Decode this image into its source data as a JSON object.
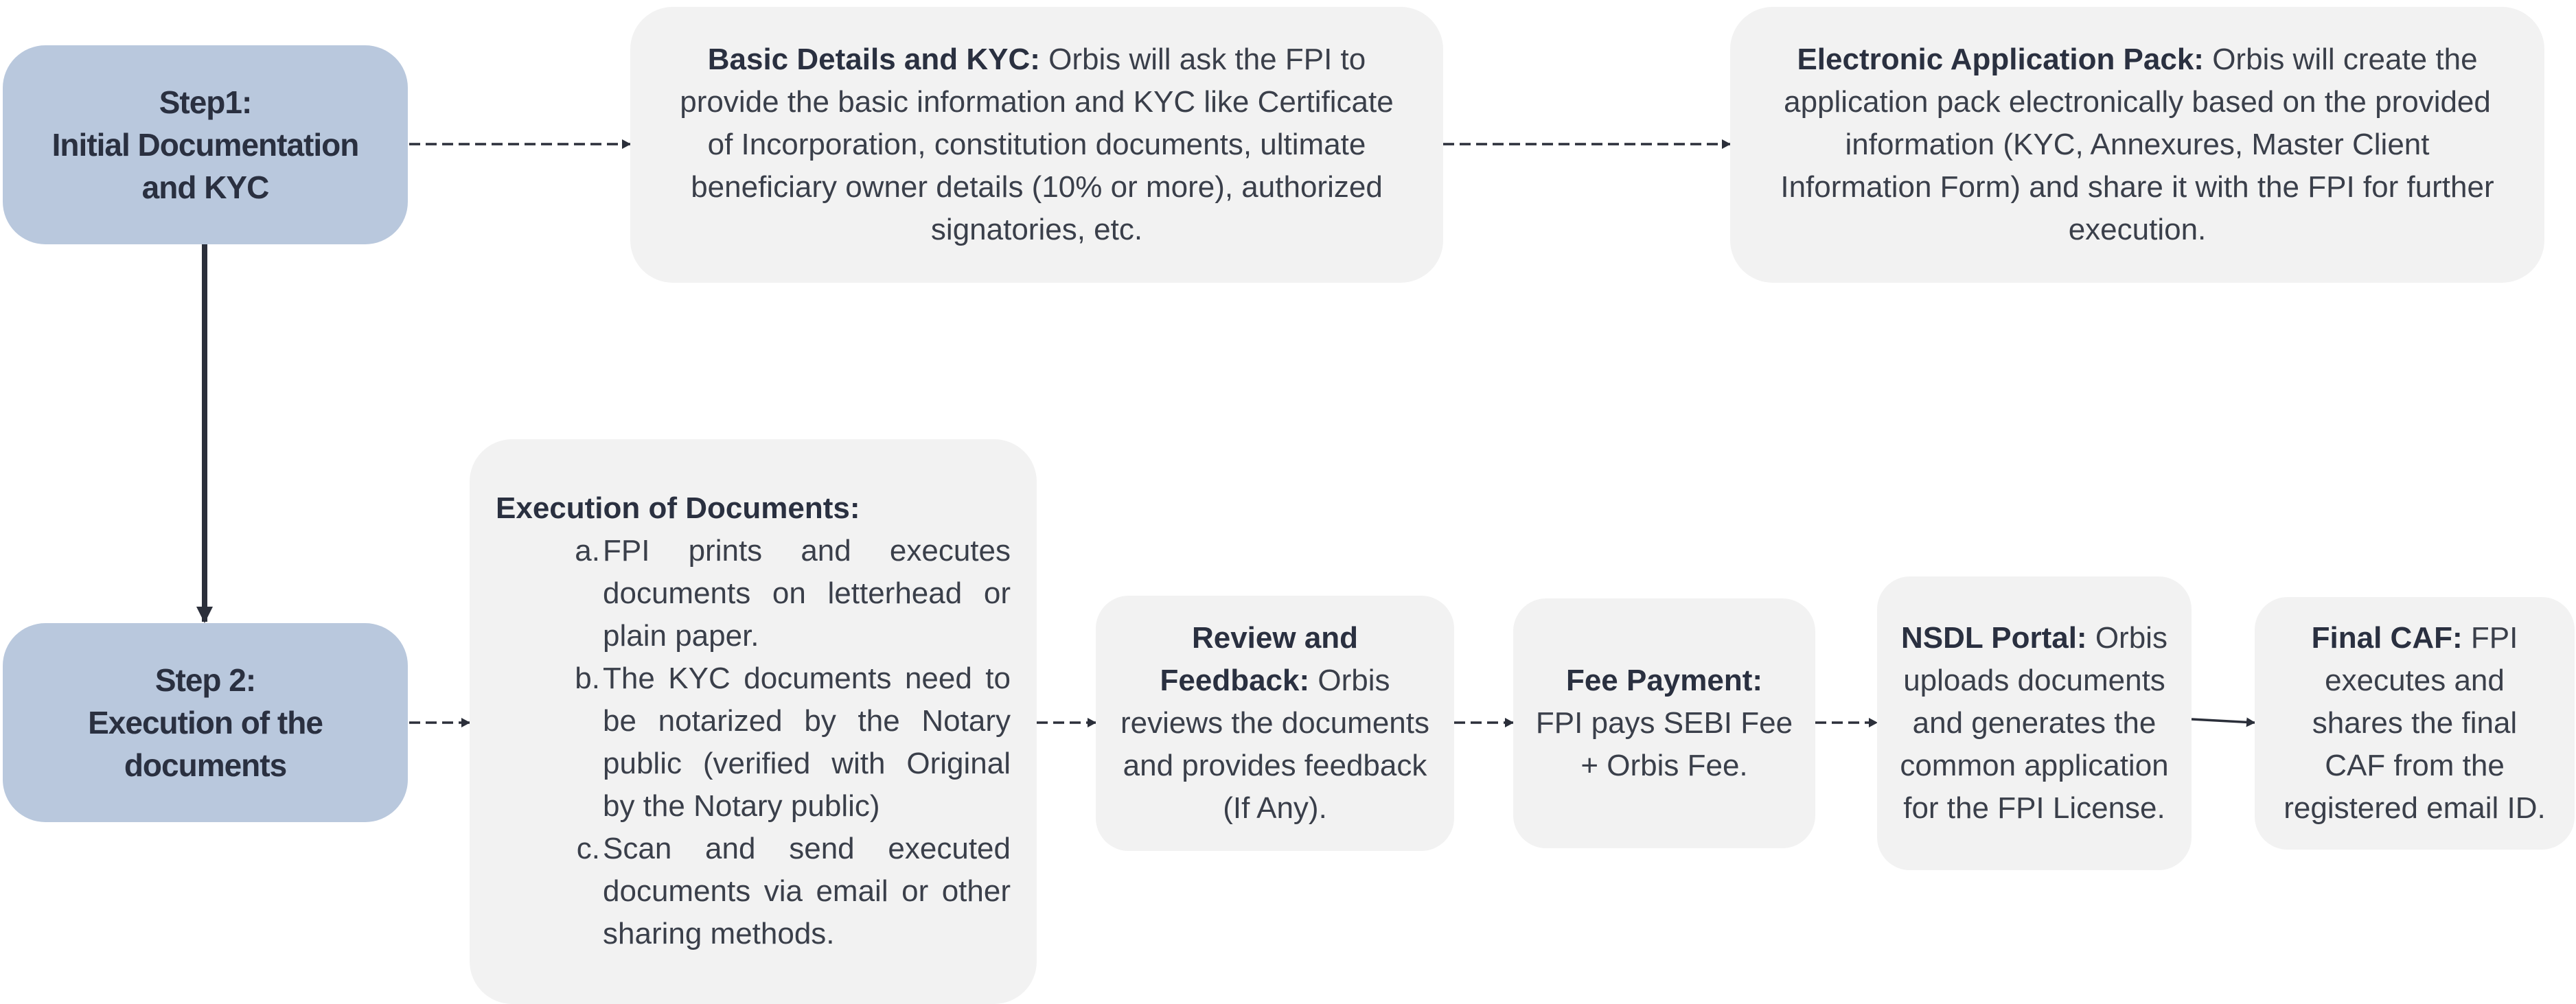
{
  "step1": {
    "line1": "Step1:",
    "line2": "Initial Documentation",
    "line3": "and KYC"
  },
  "step2": {
    "line1": "Step 2:",
    "line2": "Execution of the",
    "line3": "documents"
  },
  "basic_kyc": {
    "title": "Basic Details and KYC:",
    "text": " Orbis will ask the FPI to provide the basic information and KYC like Certificate of Incorporation, constitution documents, ultimate beneficiary owner details (10% or more), authorized signatories, etc."
  },
  "electronic_pack": {
    "title": "Electronic Application Pack:",
    "text": " Orbis will create the application pack electronically based on the provided information (KYC, Annexures, Master Client Information Form) and share it with the FPI for further execution."
  },
  "execution_docs": {
    "title": "Execution of Documents:",
    "items": [
      {
        "marker": "a.",
        "text": "FPI prints and executes documents on letterhead or plain paper."
      },
      {
        "marker": "b.",
        "text": "The KYC documents need to be notarized by the Notary public (verified with Original by the Notary public)"
      },
      {
        "marker": "c.",
        "text": "Scan and send executed documents via email or other sharing methods."
      }
    ]
  },
  "review": {
    "title": "Review and Feedback:",
    "text": " Orbis reviews the documents and provides feedback (If Any)."
  },
  "fee_payment": {
    "title": "Fee Payment:",
    "text": "FPI pays SEBI Fee + Orbis Fee."
  },
  "nsdl_portal": {
    "title": "NSDL Portal:",
    "text": " Orbis uploads documents and generates the common application for the FPI License."
  },
  "final_caf": {
    "title": "Final CAF:",
    "text": " FPI executes and shares the final CAF from the registered email ID."
  },
  "colors": {
    "step_fill": "#b9c8dd",
    "card_fill": "#f2f2f2",
    "connector": "#2b2f3a"
  }
}
